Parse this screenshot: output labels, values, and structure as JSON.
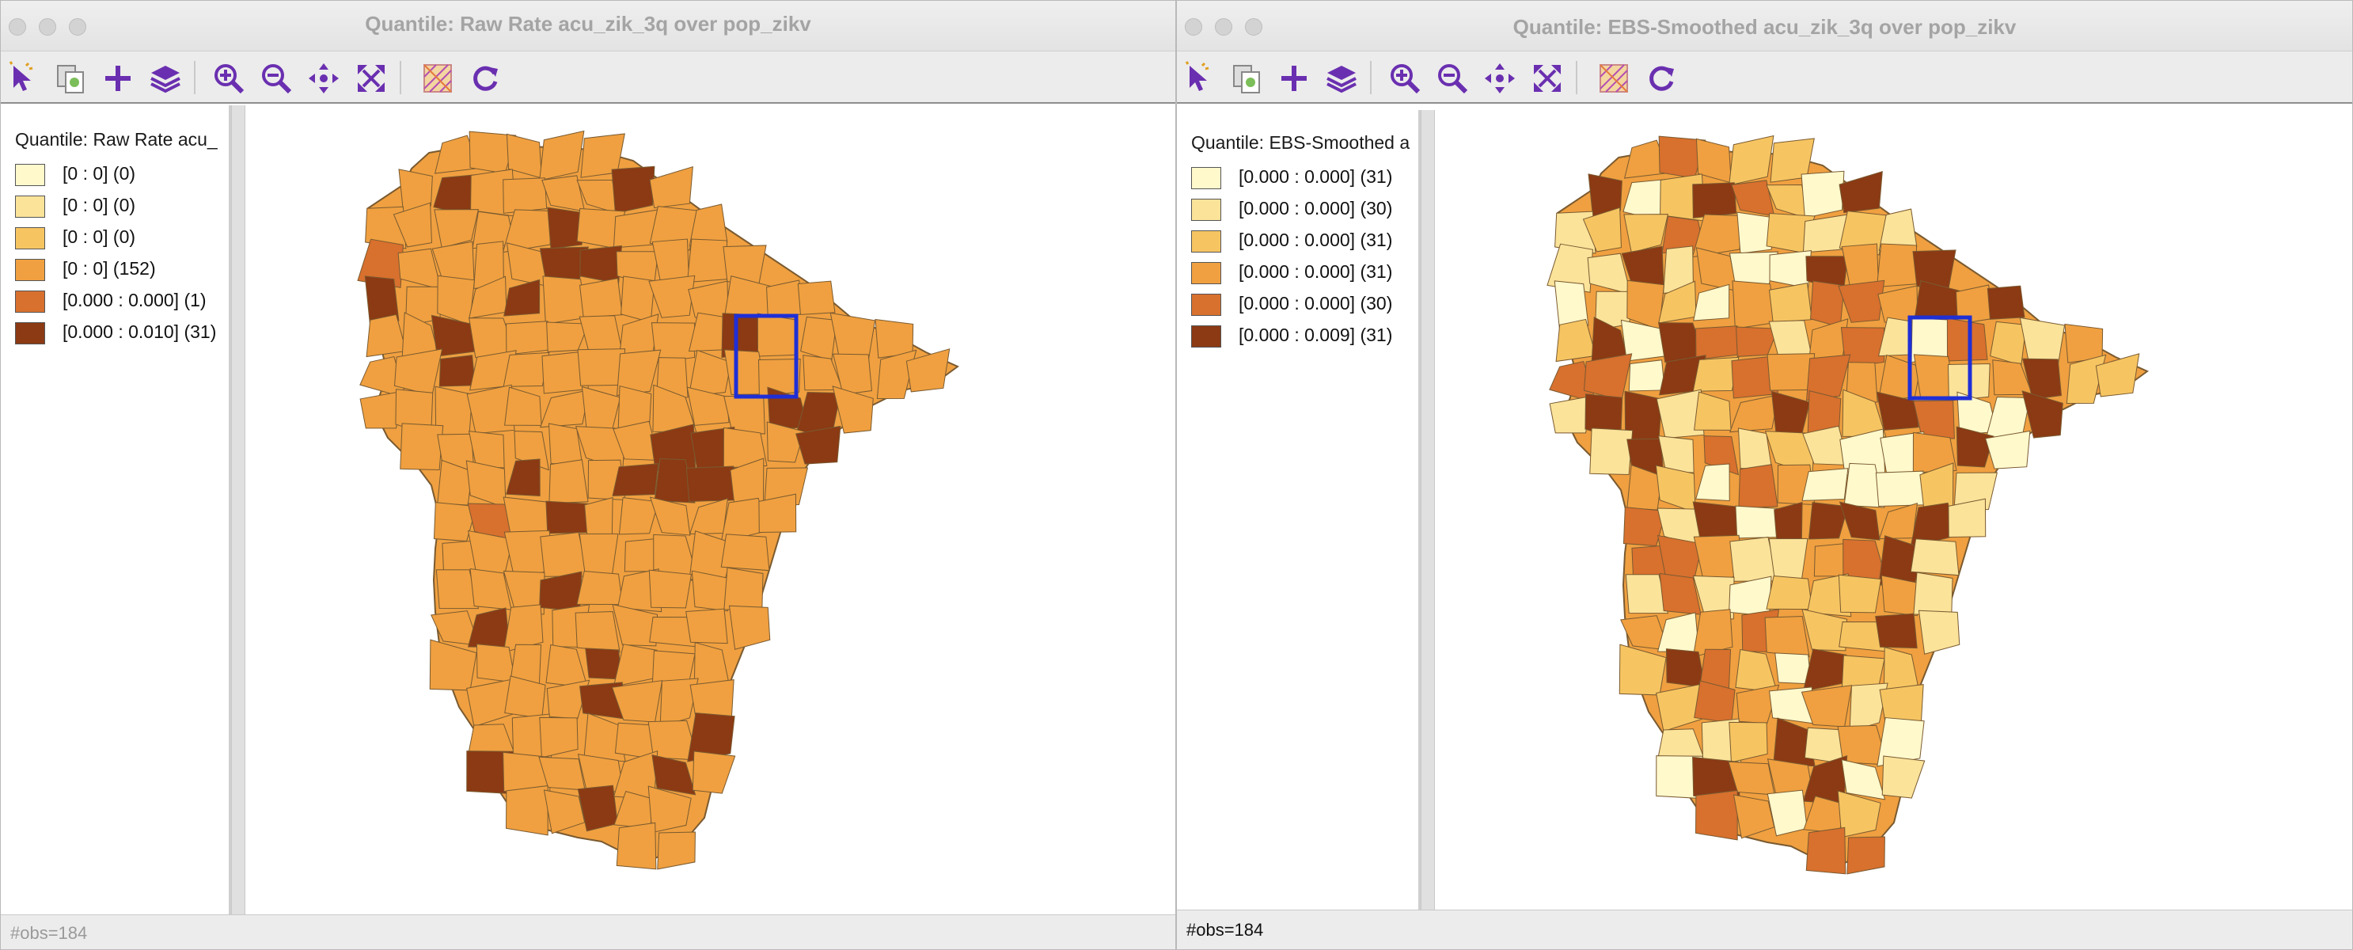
{
  "left_window": {
    "title": "Quantile: Raw Rate acu_zik_3q over pop_zikv",
    "legend_title": "Quantile: Raw Rate acu_",
    "legend": [
      {
        "label": "[0 : 0] (0)",
        "color": "#fff9cc"
      },
      {
        "label": "[0 : 0] (0)",
        "color": "#fbe39a"
      },
      {
        "label": "[0 : 0] (0)",
        "color": "#f6c562"
      },
      {
        "label": "[0 : 0] (152)",
        "color": "#f0a040"
      },
      {
        "label": "[0.000 : 0.000] (1)",
        "color": "#d8702e"
      },
      {
        "label": "[0.000 : 0.010] (31)",
        "color": "#8b3a14"
      }
    ],
    "status": "#obs=184",
    "toolbar_icons": [
      "select-pointer-icon",
      "copy-image-icon",
      "add-icon",
      "layers-icon",
      "zoom-in-icon",
      "zoom-out-icon",
      "pan-icon",
      "fit-extent-icon",
      "map-theme-icon",
      "refresh-icon"
    ]
  },
  "right_window": {
    "title": "Quantile: EBS-Smoothed acu_zik_3q over pop_zikv",
    "legend_title": "Quantile: EBS-Smoothed a",
    "legend": [
      {
        "label": "[0.000 : 0.000] (31)",
        "color": "#fff9cc"
      },
      {
        "label": "[0.000 : 0.000] (30)",
        "color": "#fbe39a"
      },
      {
        "label": "[0.000 : 0.000] (31)",
        "color": "#f6c562"
      },
      {
        "label": "[0.000 : 0.000] (31)",
        "color": "#f0a040"
      },
      {
        "label": "[0.000 : 0.000] (30)",
        "color": "#d8702e"
      },
      {
        "label": "[0.000 : 0.009] (31)",
        "color": "#8b3a14"
      }
    ],
    "status": "#obs=184",
    "toolbar_icons": [
      "select-pointer-icon",
      "copy-image-icon",
      "add-icon",
      "layers-icon",
      "zoom-in-icon",
      "zoom-out-icon",
      "pan-icon",
      "fit-extent-icon",
      "map-theme-icon",
      "refresh-icon"
    ]
  },
  "colors": {
    "toolbar_icon": "#6a2fb0",
    "highlight_box": "#1f2fd6",
    "map_base": "#f0a040",
    "map_dark": "#8b3a14",
    "status_left": "#9a9a9a",
    "status_right": "#111111"
  }
}
